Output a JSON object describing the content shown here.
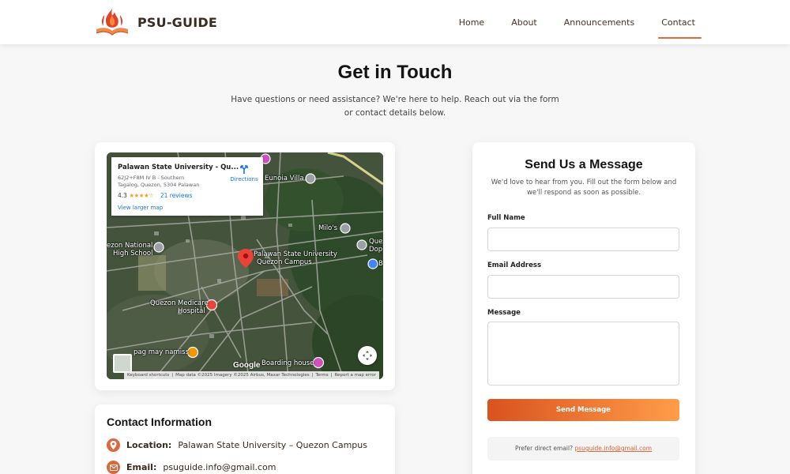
{
  "brand": {
    "name": "PSU-GUIDE",
    "accent": "#e0653a"
  },
  "nav": [
    {
      "label": "Home",
      "active": false
    },
    {
      "label": "About",
      "active": false
    },
    {
      "label": "Announcements",
      "active": false
    },
    {
      "label": "Contact",
      "active": true
    }
  ],
  "hero": {
    "title": "Get in Touch",
    "subtitle": "Have questions or need assistance? We're here to help. Reach out via the form or contact details below."
  },
  "map": {
    "popup": {
      "title": "Palawan State University - Qu...",
      "address": "62J2+F8M IV B - Southern Tagalog, Quezon, 5304 Palawan",
      "rating": "4.3",
      "stars": "★★★★☆",
      "reviews": "21 reviews",
      "larger_link": "View larger map",
      "directions": "Directions"
    },
    "labels": {
      "eunoia": "Eunoia Villa",
      "milos": "Milo's",
      "quezon_national": "ezon National",
      "high_school": "High School",
      "psu_line1": "Palawan State University",
      "psu_line2": "Quezon Campus",
      "medicare_line1": "Quezon Medicare",
      "medicare_line2": "Hospital",
      "pag_may": "pag may namiss",
      "boarding": "Boarding house",
      "right_q": "Quez",
      "right_dop": "Dopp",
      "right_b": "B"
    },
    "google": "Google",
    "footer": [
      "Keyboard shortcuts",
      "Map data ©2025 Imagery ©2025 Airbus, Maxar Technologies",
      "Terms",
      "Report a map error"
    ]
  },
  "contact_info": {
    "title": "Contact Information",
    "location_label": "Location:",
    "location_value": "Palawan State University – Quezon Campus",
    "email_label": "Email:",
    "email_value": "psuguide.info@gmail.com"
  },
  "form": {
    "title": "Send Us a Message",
    "subtitle": "We'd love to hear from you. Fill out the form below and we'll respond as soon as possible.",
    "name_label": "Full Name",
    "name_value": "",
    "email_label": "Email Address",
    "email_value": "",
    "message_label": "Message",
    "message_value": "",
    "submit_label": "Send Message",
    "alt_text": "Prefer direct email?",
    "alt_email": "psuguide.info@gmail.com"
  }
}
